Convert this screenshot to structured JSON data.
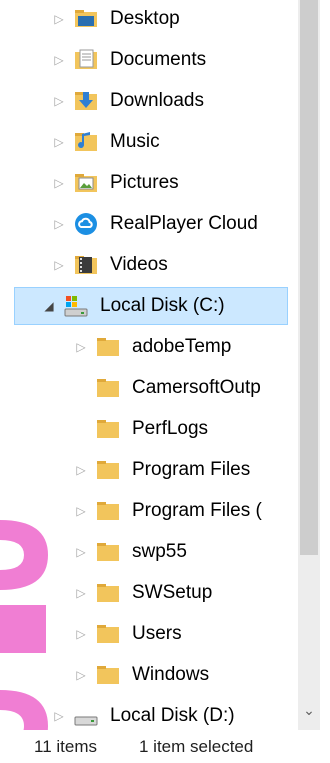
{
  "tree": [
    {
      "label": "Desktop",
      "icon": "desktop-folder-icon",
      "expander": "collapsed"
    },
    {
      "label": "Documents",
      "icon": "documents-folder-icon",
      "expander": "collapsed"
    },
    {
      "label": "Downloads",
      "icon": "downloads-folder-icon",
      "expander": "collapsed"
    },
    {
      "label": "Music",
      "icon": "music-folder-icon",
      "expander": "collapsed"
    },
    {
      "label": "Pictures",
      "icon": "pictures-folder-icon",
      "expander": "collapsed"
    },
    {
      "label": "RealPlayer Cloud",
      "icon": "realplayer-cloud-icon",
      "expander": "collapsed"
    },
    {
      "label": "Videos",
      "icon": "videos-folder-icon",
      "expander": "collapsed"
    },
    {
      "label": "Local Disk (C:)",
      "icon": "local-disk-icon",
      "expander": "expanded",
      "selected": true
    },
    {
      "label": "adobeTemp",
      "icon": "folder-icon",
      "expander": "collapsed"
    },
    {
      "label": "CamersoftOutp",
      "icon": "folder-icon",
      "expander": "none"
    },
    {
      "label": "PerfLogs",
      "icon": "folder-icon",
      "expander": "none"
    },
    {
      "label": "Program Files",
      "icon": "folder-icon",
      "expander": "collapsed"
    },
    {
      "label": "Program Files (",
      "icon": "folder-icon",
      "expander": "collapsed"
    },
    {
      "label": "swp55",
      "icon": "folder-icon",
      "expander": "collapsed"
    },
    {
      "label": "SWSetup",
      "icon": "folder-icon",
      "expander": "collapsed"
    },
    {
      "label": "Users",
      "icon": "folder-icon",
      "expander": "collapsed"
    },
    {
      "label": "Windows",
      "icon": "folder-icon",
      "expander": "collapsed"
    },
    {
      "label": "Local Disk (D:)",
      "icon": "drive-icon",
      "expander": "collapsed"
    }
  ],
  "status": {
    "item_count": "11 items",
    "selection": "1 item selected"
  },
  "colors": {
    "selection_bg": "#cce8ff",
    "selection_border": "#99d1ff",
    "folder_yellow": "#f2c55c",
    "overlay_pink": "#f07ed3"
  }
}
